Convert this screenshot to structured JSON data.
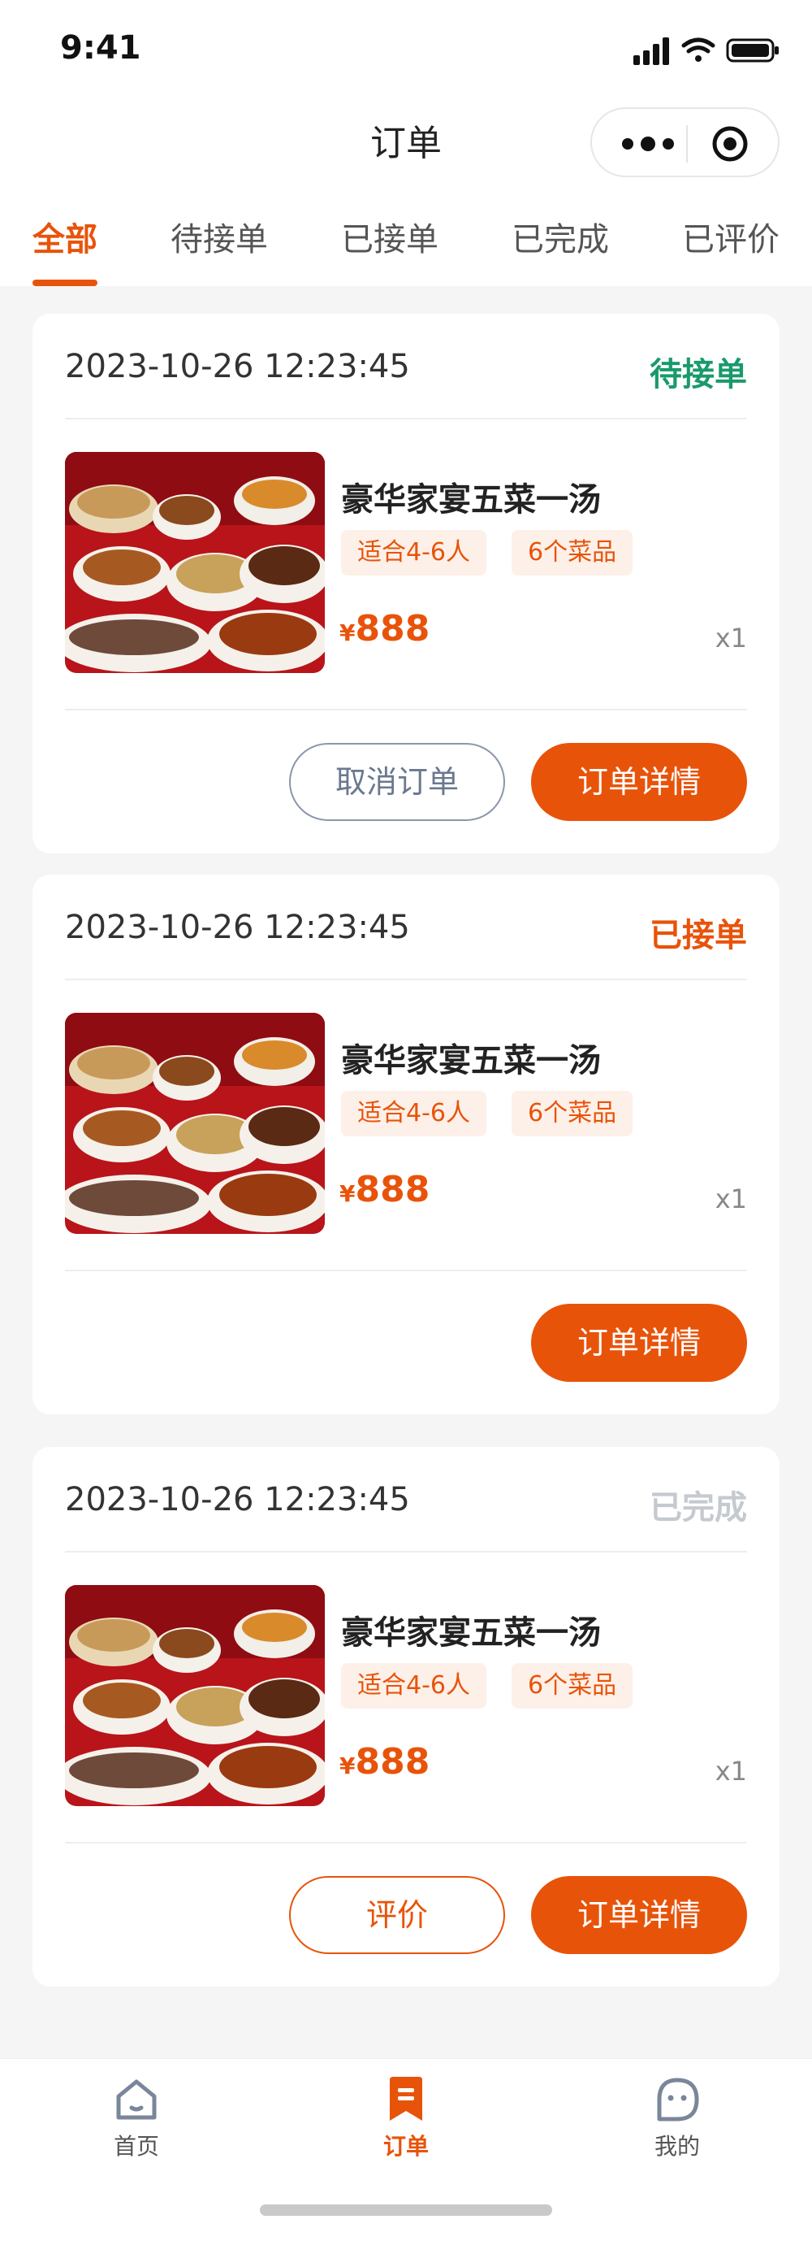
{
  "status_bar": {
    "time": "9:41"
  },
  "nav": {
    "title": "订单",
    "more_icon": "more-dots-icon",
    "close_icon": "target-circle-icon"
  },
  "tabs": [
    {
      "label": "全部",
      "active": true
    },
    {
      "label": "待接单",
      "active": false
    },
    {
      "label": "已接单",
      "active": false
    },
    {
      "label": "已完成",
      "active": false
    },
    {
      "label": "已评价",
      "active": false
    }
  ],
  "orders": [
    {
      "time": "2023-10-26 12:23:45",
      "status": "待接单",
      "status_color": "#1a9a6c",
      "dish": "豪华家宴五菜一汤",
      "tags": [
        "适合4-6人",
        "6个菜品"
      ],
      "currency": "¥",
      "price": "888",
      "qty": "x1",
      "buttons": {
        "secondary": "取消订单",
        "primary": "订单详情"
      }
    },
    {
      "time": "2023-10-26 12:23:45",
      "status": "已接单",
      "status_color": "#e8530a",
      "dish": "豪华家宴五菜一汤",
      "tags": [
        "适合4-6人",
        "6个菜品"
      ],
      "currency": "¥",
      "price": "888",
      "qty": "x1",
      "buttons": {
        "primary": "订单详情"
      }
    },
    {
      "time": "2023-10-26 12:23:45",
      "status": "已完成",
      "status_color": "#c5c9d0",
      "dish": "豪华家宴五菜一汤",
      "tags": [
        "适合4-6人",
        "6个菜品"
      ],
      "currency": "¥",
      "price": "888",
      "qty": "x1",
      "buttons": {
        "secondary": "评价",
        "primary": "订单详情"
      }
    }
  ],
  "tabbar": [
    {
      "label": "首页",
      "icon": "home-icon",
      "active": false
    },
    {
      "label": "订单",
      "icon": "order-bookmark-icon",
      "active": true
    },
    {
      "label": "我的",
      "icon": "profile-face-icon",
      "active": false
    }
  ],
  "colors": {
    "accent": "#e8530a",
    "background": "#f5f5f5"
  }
}
